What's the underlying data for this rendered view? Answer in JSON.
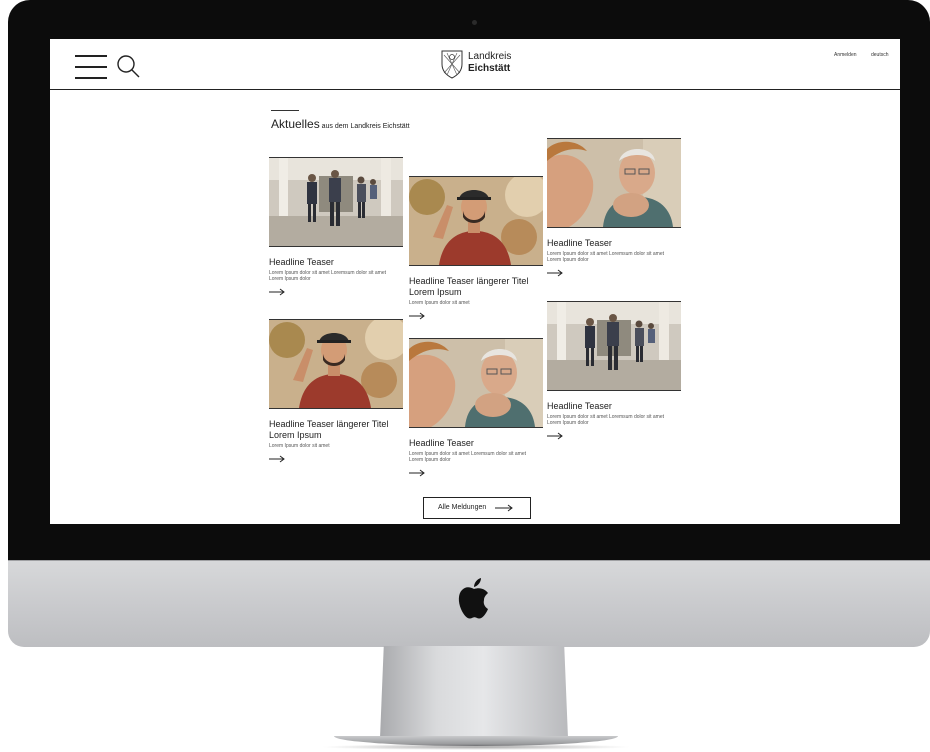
{
  "header": {
    "brand_line1": "Landkreis",
    "brand_line2": "Eichstätt",
    "login_label": "Anmelden",
    "language_label": "deutsch"
  },
  "section": {
    "title_main": "Aktuelles",
    "title_sub": " aus dem Landkreis Eichstätt"
  },
  "cards": [
    {
      "image": "corridor-people-photo",
      "headline": "Headline Teaser",
      "text": "Lorem Ipsum dolor sit amet Loremsum dolor sit amet Lorem Ipsum dolor"
    },
    {
      "image": "man-in-cap-photo",
      "headline": "Headline Teaser längerer Titel Lorem Ipsum",
      "text": "Lorem Ipsum dolor sit amet"
    },
    {
      "image": "elderly-man-photo",
      "headline": "Headline Teaser",
      "text": "Lorem Ipsum dolor sit amet Loremsum dolor sit amet Lorem Ipsum dolor"
    },
    {
      "image": "man-in-cap-photo",
      "headline": "Headline Teaser längerer Titel Lorem Ipsum",
      "text": "Lorem Ipsum dolor sit amet"
    },
    {
      "image": "elderly-man-photo",
      "headline": "Headline Teaser",
      "text": "Lorem Ipsum dolor sit amet Loremsum dolor sit amet Lorem Ipsum dolor"
    },
    {
      "image": "corridor-people-photo",
      "headline": "Headline Teaser",
      "text": "Lorem Ipsum dolor sit amet Loremsum dolor sit amet Lorem Ipsum dolor"
    }
  ],
  "all_news_button": "Alle Meldungen",
  "colors": {
    "text": "#222222",
    "bezel": "#0c0c0c",
    "screen_bg": "#ffffff"
  }
}
